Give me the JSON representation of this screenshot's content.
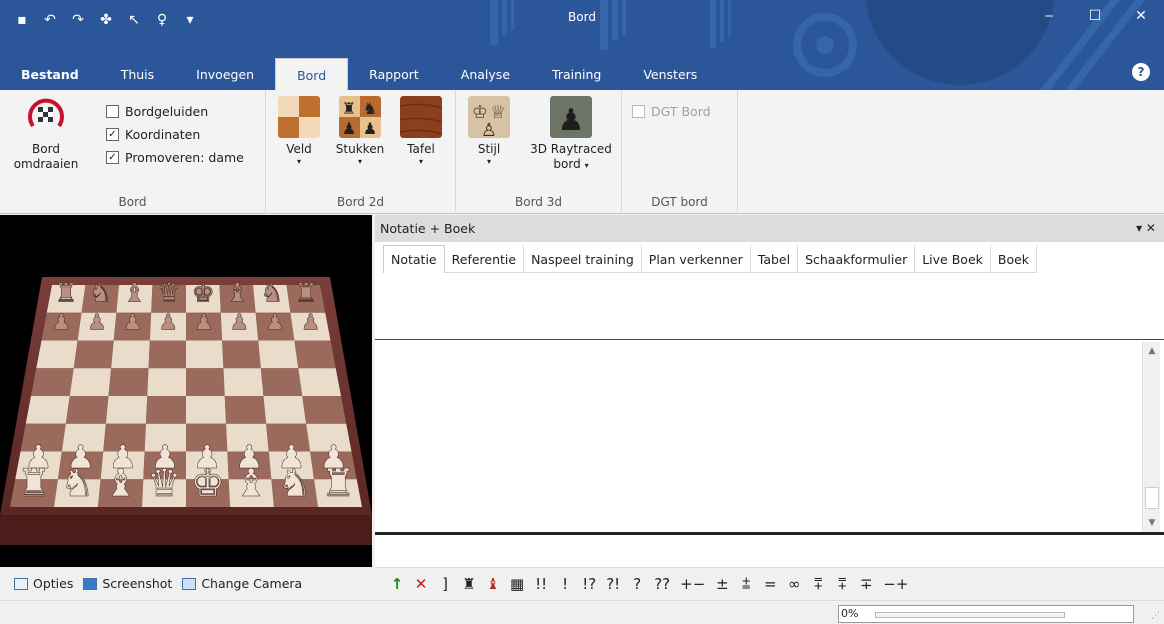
{
  "window": {
    "title": "Bord",
    "minimize_glyph": "‒",
    "maximize_glyph": "☐",
    "close_glyph": "✕"
  },
  "qat": [
    {
      "icon": "save-icon",
      "glyph": "▪"
    },
    {
      "icon": "undo-icon",
      "glyph": "↶"
    },
    {
      "icon": "redo-icon",
      "glyph": "↷"
    },
    {
      "icon": "engine-icon",
      "glyph": "✤"
    },
    {
      "icon": "tool-icon",
      "glyph": "↖"
    },
    {
      "icon": "bulb-icon",
      "glyph": "♀"
    },
    {
      "icon": "customize-icon",
      "glyph": "▾"
    }
  ],
  "ribbon_tabs": [
    {
      "label": "Bestand"
    },
    {
      "label": "Thuis"
    },
    {
      "label": "Invoegen"
    },
    {
      "label": "Bord"
    },
    {
      "label": "Rapport"
    },
    {
      "label": "Analyse"
    },
    {
      "label": "Training"
    },
    {
      "label": "Vensters"
    }
  ],
  "active_ribbon_tab": "Bord",
  "help_glyph": "?",
  "ribbon": {
    "bord_group": {
      "label": "Bord",
      "flip_button": "Bord\nomdraaien",
      "flip_line1": "Bord",
      "flip_line2": "omdraaien",
      "checkboxes": [
        {
          "label": "Bordgeluiden",
          "checked": false
        },
        {
          "label": "Koordinaten",
          "checked": true
        },
        {
          "label": "Promoveren: dame",
          "checked": true
        }
      ]
    },
    "bord2d_group": {
      "label": "Bord 2d",
      "veld": "Veld",
      "stukken": "Stukken",
      "tafel": "Tafel"
    },
    "bord3d_group": {
      "label": "Bord 3d",
      "stijl": "Stijl",
      "raytraced_line1": "3D Raytraced",
      "raytraced_line2": "bord"
    },
    "dgt_group": {
      "label": "DGT bord",
      "dgt_checkbox": "DGT Bord"
    },
    "check_mark": "✓",
    "dropdown_arrow": "▾"
  },
  "board_toolbar": {
    "opties": "Opties",
    "screenshot": "Screenshot",
    "change_camera": "Change Camera"
  },
  "notation_pane": {
    "title": "Notatie + Boek",
    "controls": "▾ ✕",
    "tabs": [
      {
        "label": "Notatie"
      },
      {
        "label": "Referentie"
      },
      {
        "label": "Naspeel training"
      },
      {
        "label": "Plan verkenner"
      },
      {
        "label": "Tabel"
      },
      {
        "label": "Schaakformulier"
      },
      {
        "label": "Live Boek"
      },
      {
        "label": "Boek"
      }
    ],
    "active_tab": "Notatie",
    "scroll_up": "▲",
    "scroll_down": "▼"
  },
  "annotations": [
    {
      "sym": "↑",
      "style": "green",
      "name": "arrow-up"
    },
    {
      "sym": "✕",
      "style": "red",
      "name": "delete"
    },
    {
      "sym": "]",
      "style": "",
      "name": "bracket"
    },
    {
      "sym": "♜",
      "style": "",
      "name": "piece-a"
    },
    {
      "sym": "♝",
      "style": "red",
      "name": "piece-b"
    },
    {
      "sym": "▦",
      "style": "",
      "name": "board"
    },
    {
      "sym": "!!",
      "style": "",
      "name": "brilliant"
    },
    {
      "sym": "!",
      "style": "",
      "name": "good"
    },
    {
      "sym": "!?",
      "style": "",
      "name": "interesting"
    },
    {
      "sym": "?!",
      "style": "",
      "name": "dubious"
    },
    {
      "sym": "?",
      "style": "",
      "name": "mistake"
    },
    {
      "sym": "??",
      "style": "",
      "name": "blunder"
    },
    {
      "sym": "+−",
      "style": "",
      "name": "white-wins"
    },
    {
      "sym": "±",
      "style": "",
      "name": "white-better"
    },
    {
      "sym": "⩲",
      "style": "",
      "name": "white-slightly"
    },
    {
      "sym": "=",
      "style": "",
      "name": "equal"
    },
    {
      "sym": "∞",
      "style": "",
      "name": "unclear"
    },
    {
      "sym": "⩱",
      "style": "",
      "name": "compensation"
    },
    {
      "sym": "⩱",
      "style": "",
      "name": "black-slightly"
    },
    {
      "sym": "∓",
      "style": "",
      "name": "black-better"
    },
    {
      "sym": "−+",
      "style": "",
      "name": "black-wins"
    }
  ],
  "status": {
    "progress_text": "0%",
    "progress_value": 0
  },
  "colors": {
    "titlebar": "#2b579a",
    "ribbon": "#f3f3f3"
  }
}
